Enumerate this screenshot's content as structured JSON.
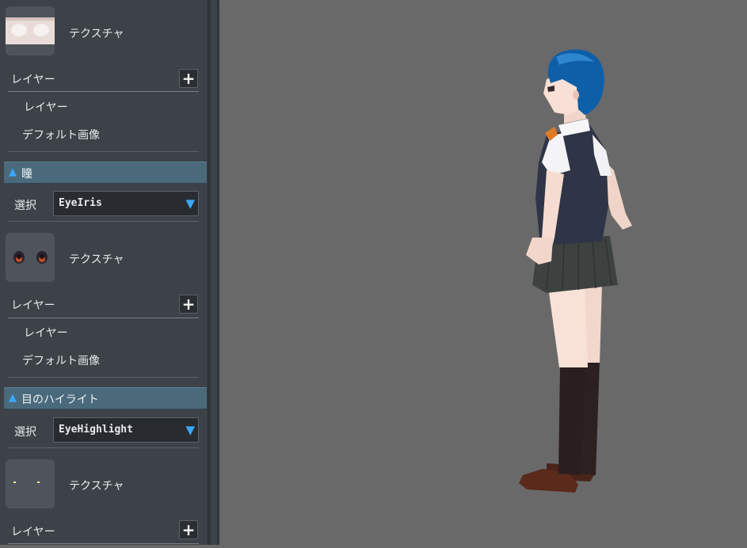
{
  "panel": {
    "texture_label": "テクスチャ",
    "layer_header": "レイヤー",
    "layer_item": "レイヤー",
    "default_image": "デフォルト画像",
    "select_label": "選択",
    "sections": [
      {
        "title": "瞳",
        "selected": "EyeIris"
      },
      {
        "title": "目のハイライト",
        "selected": "EyeHighlight"
      }
    ],
    "icons": {
      "add": "+",
      "collapse": "▲",
      "dropdown": "▼"
    }
  },
  "colors": {
    "panel_bg": "#3c4247",
    "section_header_bg": "#4a6a7c",
    "accent": "#3aa8ff",
    "viewport_bg": "#696969"
  }
}
